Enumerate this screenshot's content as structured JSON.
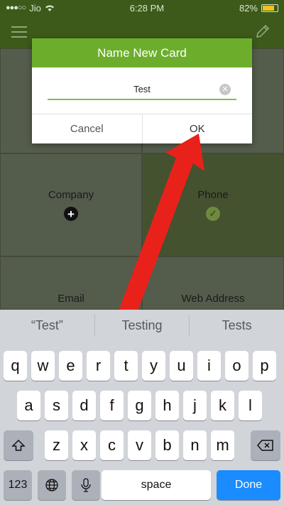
{
  "status_bar": {
    "carrier": "Jio",
    "signal": "●●●○○",
    "wifi_icon": "wifi-icon",
    "time": "6:28 PM",
    "battery": "82%",
    "battery_level": 0.82
  },
  "dialog": {
    "title": "Name New Card",
    "input_value": "Test",
    "cancel_label": "Cancel",
    "ok_label": "OK"
  },
  "tiles": {
    "company": "Company",
    "phone": "Phone",
    "email": "Email",
    "web": "Web Address"
  },
  "suggestions": [
    "“Test”",
    "Testing",
    "Tests"
  ],
  "keyboard": {
    "row1": [
      "q",
      "w",
      "e",
      "r",
      "t",
      "y",
      "u",
      "i",
      "o",
      "p"
    ],
    "row2": [
      "a",
      "s",
      "d",
      "f",
      "g",
      "h",
      "j",
      "k",
      "l"
    ],
    "row3": [
      "z",
      "x",
      "c",
      "v",
      "b",
      "n",
      "m"
    ],
    "numbers_label": "123",
    "space_label": "space",
    "done_label": "Done"
  },
  "colors": {
    "header_green": "#3d5a1a",
    "dialog_title_green": "#6cae2c",
    "done_blue": "#1a8cff",
    "arrow_red": "#e8221b"
  }
}
